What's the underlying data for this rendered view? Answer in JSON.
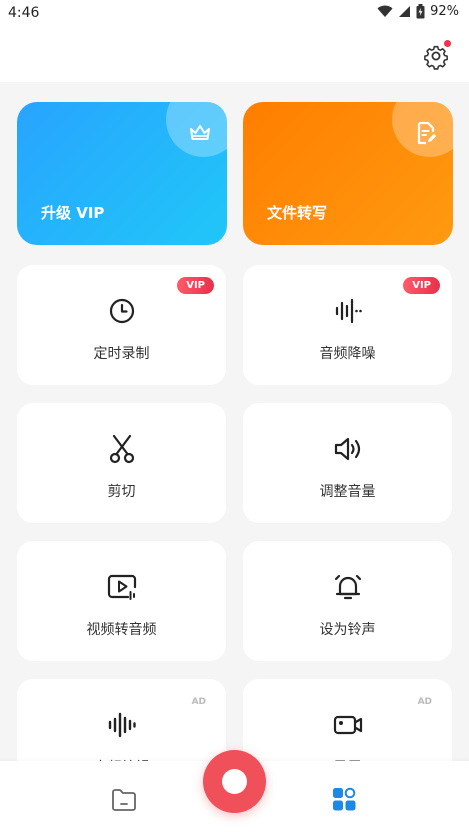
{
  "status": {
    "time": "4:46",
    "battery": "92%"
  },
  "header": {
    "settings_icon": "gear-icon"
  },
  "big_cards": [
    {
      "label": "升级 VIP",
      "icon": "crown-icon"
    },
    {
      "label": "文件转写",
      "icon": "document-edit-icon"
    }
  ],
  "tools": [
    {
      "label": "定时录制",
      "badge": "VIP",
      "icon": "clock-icon"
    },
    {
      "label": "音频降噪",
      "badge": "VIP",
      "icon": "waveform-icon"
    },
    {
      "label": "剪切",
      "icon": "scissors-icon"
    },
    {
      "label": "调整音量",
      "icon": "speaker-icon"
    },
    {
      "label": "视频转音频",
      "icon": "video-to-audio-icon"
    },
    {
      "label": "设为铃声",
      "icon": "bell-icon"
    },
    {
      "label": "音频编辑",
      "badge": "AD",
      "icon": "audio-edit-icon"
    },
    {
      "label": "录屏",
      "badge": "AD",
      "icon": "screen-record-icon"
    }
  ],
  "bottom_nav": {
    "files_icon": "folder-icon",
    "record_icon": "record-icon",
    "tools_icon": "tools-grid-icon"
  },
  "colors": {
    "vip_blue": "#28a4ff",
    "orange": "#ff8a00",
    "record_red": "#f0505a",
    "nav_active": "#1e88e5"
  }
}
